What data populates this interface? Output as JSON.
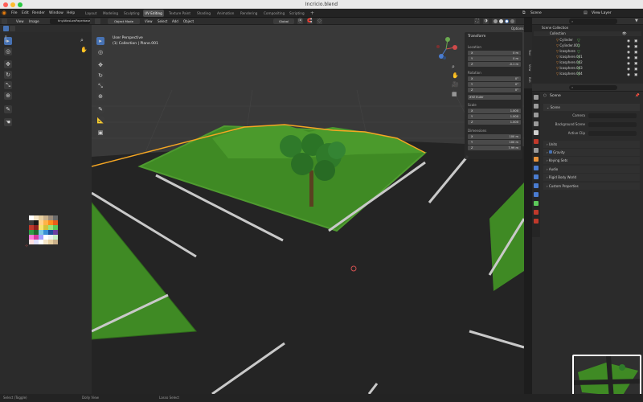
{
  "window": {
    "title": "Incricio.blend"
  },
  "topbar": {
    "menus": [
      "File",
      "Edit",
      "Render",
      "Window",
      "Help"
    ],
    "workspaces": [
      "Layout",
      "Modeling",
      "Sculpting",
      "UV Editing",
      "Texture Paint",
      "Shading",
      "Animation",
      "Rendering",
      "Compositing",
      "Scripting"
    ],
    "active_workspace": "UV Editing",
    "scene_label": "Scene",
    "view_layer_label": "View Layer"
  },
  "uv_editor": {
    "menus": [
      "View",
      "Image"
    ],
    "image_name": "tinyAtlasLowPaperbased"
  },
  "viewport": {
    "mode": "Object Mode",
    "menus": [
      "View",
      "Select",
      "Add",
      "Object"
    ],
    "transform_orientation": "Global",
    "options_label": "Options",
    "overlay_line1": "User Perspective",
    "overlay_line2": "(1) Collection | Plane.001"
  },
  "npanel": {
    "header": "Transform",
    "location_label": "Location",
    "location": [
      {
        "axis": "X",
        "value": "0 m"
      },
      {
        "axis": "Y",
        "value": "0 m"
      },
      {
        "axis": "Z",
        "value": "-0.1 m"
      }
    ],
    "rotation_label": "Rotation",
    "rotation": [
      {
        "axis": "X",
        "value": "0°"
      },
      {
        "axis": "Y",
        "value": "0°"
      },
      {
        "axis": "Z",
        "value": "0°"
      }
    ],
    "rotation_mode": "XYZ Euler",
    "scale_label": "Scale",
    "scale": [
      {
        "axis": "X",
        "value": "1.000"
      },
      {
        "axis": "Y",
        "value": "1.000"
      },
      {
        "axis": "Z",
        "value": "1.000"
      }
    ],
    "dimensions_label": "Dimensions",
    "dimensions": [
      {
        "axis": "X",
        "value": "100 m"
      },
      {
        "axis": "Y",
        "value": "100 m"
      },
      {
        "axis": "Z",
        "value": "7.99 m"
      }
    ],
    "side_tabs": [
      "Item",
      "Tool",
      "View",
      "Edit"
    ]
  },
  "outliner": {
    "root": "Scene Collection",
    "collection": "Collection",
    "items": [
      "Cylinder",
      "Cylinder.001",
      "Icosphere",
      "Icosphere.001",
      "Icosphere.002",
      "Icosphere.003",
      "Icosphere.004"
    ]
  },
  "properties": {
    "scene_name": "Scene",
    "section": "Scene",
    "fields": [
      {
        "label": "Camera",
        "value": ""
      },
      {
        "label": "Background Scene",
        "value": ""
      },
      {
        "label": "Active Clip",
        "value": ""
      }
    ],
    "panels": [
      "Units",
      "Gravity",
      "Keying Sets",
      "Audio",
      "Rigid Body World",
      "Custom Properties"
    ]
  },
  "statusbar": {
    "items": [
      "Select (Toggle)",
      "Dolly View",
      "Lasso Select"
    ]
  },
  "colors": {
    "accent": "#4772b3",
    "selection_outline": "#f5a623",
    "grass": "#3f8a24",
    "road": "#252525"
  }
}
